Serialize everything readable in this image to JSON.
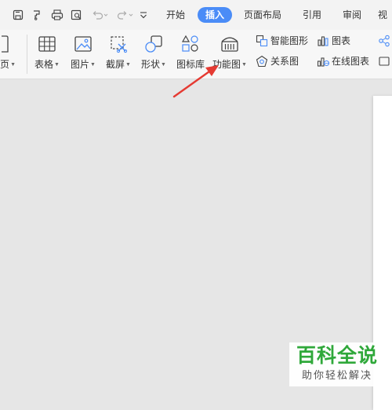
{
  "menu": {
    "tabs": [
      {
        "label": "开始",
        "active": false
      },
      {
        "label": "插入",
        "active": true
      },
      {
        "label": "页面布局",
        "active": false
      },
      {
        "label": "引用",
        "active": false
      },
      {
        "label": "审阅",
        "active": false
      },
      {
        "label": "视",
        "active": false
      }
    ],
    "quick_access_icons": [
      "save-icon",
      "format-painter-icon",
      "print-icon",
      "print-preview-icon",
      "undo-icon",
      "redo-icon",
      "customize-quick-access-icon"
    ]
  },
  "ribbon": {
    "page_button": {
      "label": "页",
      "has_dropdown": true
    },
    "big_buttons": [
      {
        "label": "表格",
        "has_dropdown": true,
        "icon": "table-icon"
      },
      {
        "label": "图片",
        "has_dropdown": true,
        "icon": "picture-icon"
      },
      {
        "label": "截屏",
        "has_dropdown": true,
        "icon": "screenshot-icon"
      },
      {
        "label": "形状",
        "has_dropdown": true,
        "icon": "shapes-icon"
      },
      {
        "label": "图标库",
        "has_dropdown": false,
        "icon": "icon-library-icon"
      },
      {
        "label": "功能图",
        "has_dropdown": true,
        "icon": "function-chart-icon"
      }
    ],
    "small_buttons": [
      {
        "label": "智能图形",
        "icon": "smart-art-icon"
      },
      {
        "label": "关系图",
        "icon": "relationship-chart-icon"
      },
      {
        "label": "图表",
        "icon": "chart-icon"
      },
      {
        "label": "在线图表",
        "icon": "online-chart-icon"
      }
    ]
  },
  "watermark": {
    "title": "百科全说",
    "subtitle": "助你轻松解决"
  },
  "colors": {
    "active_tab": "#4a8cf7",
    "arrow": "#e53a32",
    "watermark_green": "#2fa83a",
    "icon_blue": "#4a8cf7"
  }
}
